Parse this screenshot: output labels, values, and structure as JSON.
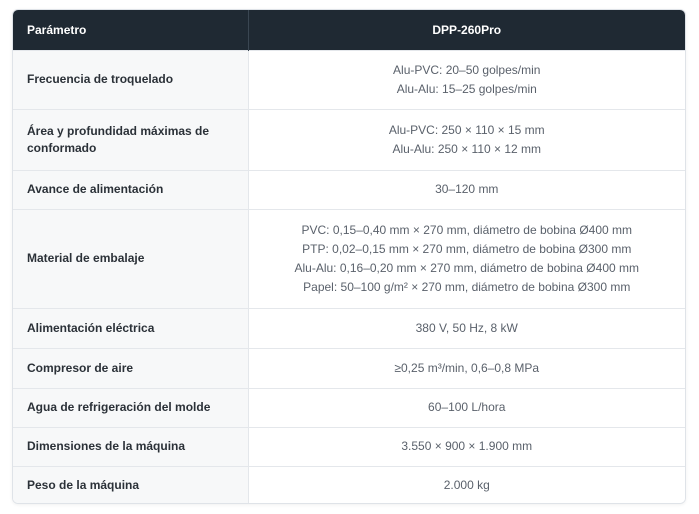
{
  "table": {
    "header": {
      "parameter": "Parámetro",
      "model": "DPP-260Pro"
    },
    "rows": [
      {
        "label": "Frecuencia de troquelado",
        "values": [
          "Alu-PVC: 20–50 golpes/min",
          "Alu-Alu: 15–25 golpes/min"
        ]
      },
      {
        "label": "Área y profundidad máximas de conformado",
        "values": [
          "Alu-PVC: 250 × 110 × 15 mm",
          "Alu-Alu: 250 × 110 × 12 mm"
        ]
      },
      {
        "label": "Avance de alimentación",
        "values": [
          "30–120 mm"
        ]
      },
      {
        "label": "Material de embalaje",
        "values": [
          "PVC: 0,15–0,40 mm × 270 mm, diámetro de bobina Ø400 mm",
          "PTP: 0,02–0,15 mm × 270 mm, diámetro de bobina Ø300 mm",
          "Alu-Alu: 0,16–0,20 mm × 270 mm, diámetro de bobina Ø400 mm",
          "Papel: 50–100 g/m² × 270 mm, diámetro de bobina Ø300 mm"
        ]
      },
      {
        "label": "Alimentación eléctrica",
        "values": [
          "380 V, 50 Hz, 8 kW"
        ]
      },
      {
        "label": "Compresor de aire",
        "values": [
          "≥0,25 m³/min, 0,6–0,8 MPa"
        ]
      },
      {
        "label": "Agua de refrigeración del molde",
        "values": [
          "60–100 L/hora"
        ]
      },
      {
        "label": "Dimensiones de la máquina",
        "values": [
          "3.550 × 900 × 1.900 mm"
        ]
      },
      {
        "label": "Peso de la máquina",
        "values": [
          "2.000 kg"
        ]
      }
    ]
  }
}
